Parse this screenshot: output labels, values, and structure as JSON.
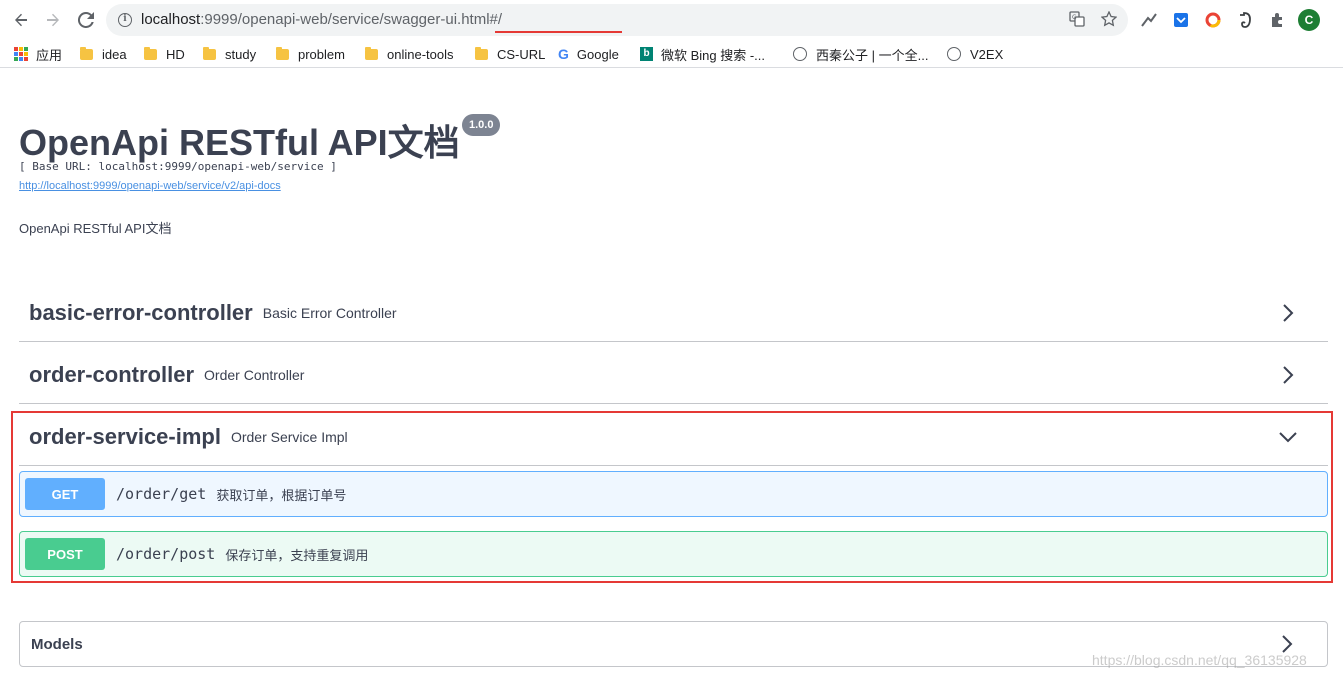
{
  "browser": {
    "url_host": "localhost",
    "url_rest": ":9999/openapi-web/service/",
    "url_highlight": "swagger-ui.html#/",
    "avatar_letter": "C",
    "bookmarks": [
      {
        "label": "应用",
        "type": "apps"
      },
      {
        "label": "idea",
        "type": "folder"
      },
      {
        "label": "HD",
        "type": "folder"
      },
      {
        "label": "study",
        "type": "folder"
      },
      {
        "label": "problem",
        "type": "folder"
      },
      {
        "label": "online-tools",
        "type": "folder"
      },
      {
        "label": "CS-URL",
        "type": "folder"
      },
      {
        "label": "Google",
        "type": "google"
      },
      {
        "label": "微软 Bing 搜索 -...",
        "type": "bing"
      },
      {
        "label": "西秦公子 | 一个全...",
        "type": "globe"
      },
      {
        "label": "V2EX",
        "type": "globe"
      }
    ]
  },
  "swagger": {
    "title": "OpenApi RESTful API文档",
    "version": "1.0.0",
    "base_url": "[ Base URL: localhost:9999/openapi-web/service ]",
    "docs_link": "http://localhost:9999/openapi-web/service/v2/api-docs",
    "description": "OpenApi RESTful API文档",
    "tags": [
      {
        "name": "basic-error-controller",
        "desc": "Basic Error Controller",
        "expanded": false
      },
      {
        "name": "order-controller",
        "desc": "Order Controller",
        "expanded": false
      },
      {
        "name": "order-service-impl",
        "desc": "Order Service Impl",
        "expanded": true
      }
    ],
    "operations": [
      {
        "method": "GET",
        "path": "/order/get",
        "summary": "获取订单，根据订单号"
      },
      {
        "method": "POST",
        "path": "/order/post",
        "summary": "保存订单，支持重复调用"
      }
    ],
    "models_title": "Models"
  },
  "watermark": "https://blog.csdn.net/qq_36135928",
  "colors": {
    "get": "#61affe",
    "post": "#49cc90",
    "highlight": "#e53935",
    "text": "#3b4151"
  }
}
